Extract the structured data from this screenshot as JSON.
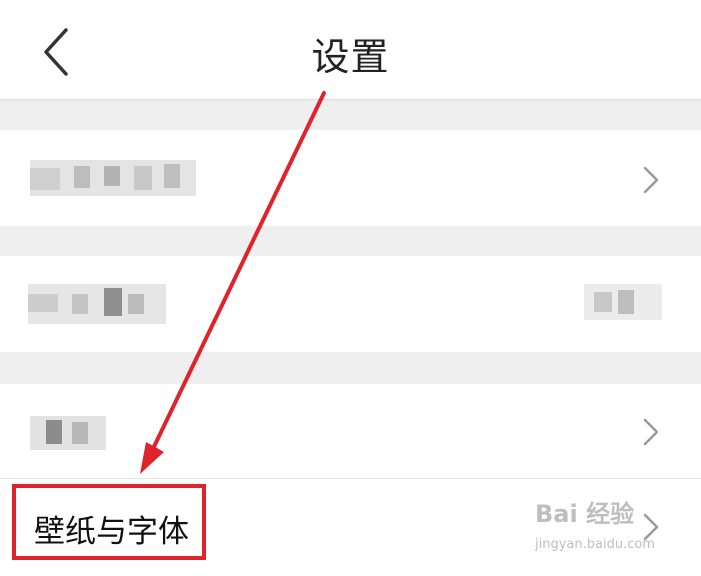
{
  "header": {
    "title": "设置",
    "back_icon": "chevron-left-icon"
  },
  "rows": [
    {
      "label": "",
      "value": "",
      "chevron": true,
      "redacted": true
    },
    {
      "label": "",
      "value": "",
      "chevron": false,
      "redacted": true
    },
    {
      "label": "",
      "value": "",
      "chevron": true,
      "redacted": true
    },
    {
      "label": "壁纸与字体",
      "value": "",
      "chevron": true,
      "redacted": false
    }
  ],
  "watermark": {
    "line1": "Bai 经验",
    "line2": "jingyan.baidu.com"
  },
  "colors": {
    "highlight": "#e0222b",
    "section_gap": "#efefef",
    "chevron": "#9a9a9a"
  }
}
